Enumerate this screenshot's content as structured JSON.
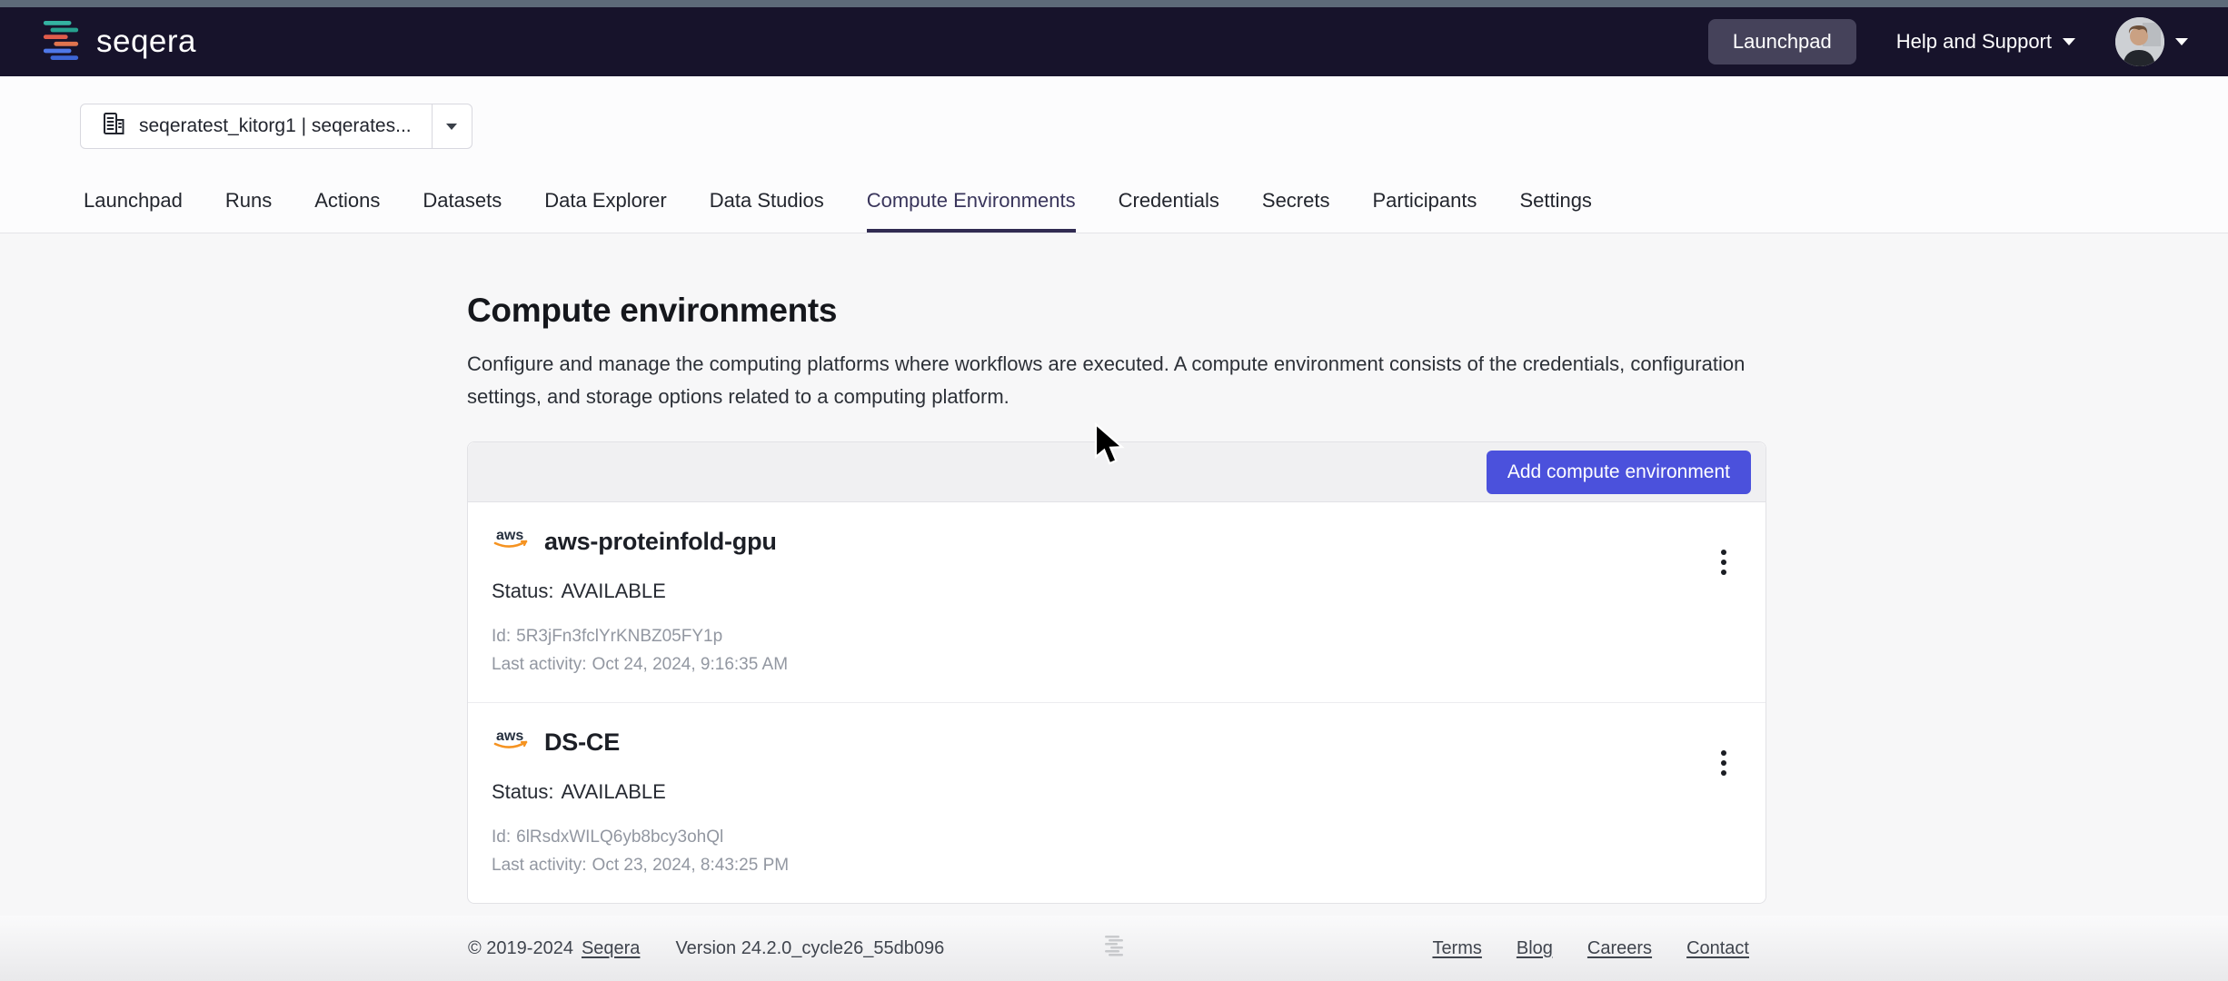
{
  "colors": {
    "navbar_bg": "#17132b",
    "accent_button": "#4b51dc",
    "active_tab_underline": "#312b52",
    "aws_smile_orange": "#f59321"
  },
  "topbar": {
    "brand": "seqera",
    "launchpad_label": "Launchpad",
    "help_label": "Help and Support"
  },
  "workspace_selector": {
    "value": "seqeratest_kitorg1 | seqerates..."
  },
  "tabs": [
    {
      "label": "Launchpad"
    },
    {
      "label": "Runs"
    },
    {
      "label": "Actions"
    },
    {
      "label": "Datasets"
    },
    {
      "label": "Data Explorer"
    },
    {
      "label": "Data Studios"
    },
    {
      "label": "Compute Environments",
      "active": true
    },
    {
      "label": "Credentials"
    },
    {
      "label": "Secrets"
    },
    {
      "label": "Participants"
    },
    {
      "label": "Settings"
    }
  ],
  "page": {
    "title": "Compute environments",
    "description": "Configure and manage the computing platforms where workflows are executed. A compute environment consists of the credentials, configuration settings, and storage options related to a computing platform.",
    "add_button_label": "Add compute environment"
  },
  "environments": [
    {
      "provider_icon": "aws-icon",
      "provider_text": "aws",
      "name": "aws-proteinfold-gpu",
      "status_label": "Status:",
      "status": "AVAILABLE",
      "id_label": "Id:",
      "id": "5R3jFn3fclYrKNBZ05FY1p",
      "last_activity_label": "Last activity:",
      "last_activity": "Oct 24, 2024, 9:16:35 AM"
    },
    {
      "provider_icon": "aws-icon",
      "provider_text": "aws",
      "name": "DS-CE",
      "status_label": "Status:",
      "status": "AVAILABLE",
      "id_label": "Id:",
      "id": "6lRsdxWILQ6yb8bcy3ohQl",
      "last_activity_label": "Last activity:",
      "last_activity": "Oct 23, 2024, 8:43:25 PM"
    }
  ],
  "footer": {
    "copyright": "© 2019-2024",
    "company_link": "Seqera",
    "version": "Version 24.2.0_cycle26_55db096",
    "links": [
      "Terms",
      "Blog",
      "Careers",
      "Contact"
    ]
  }
}
